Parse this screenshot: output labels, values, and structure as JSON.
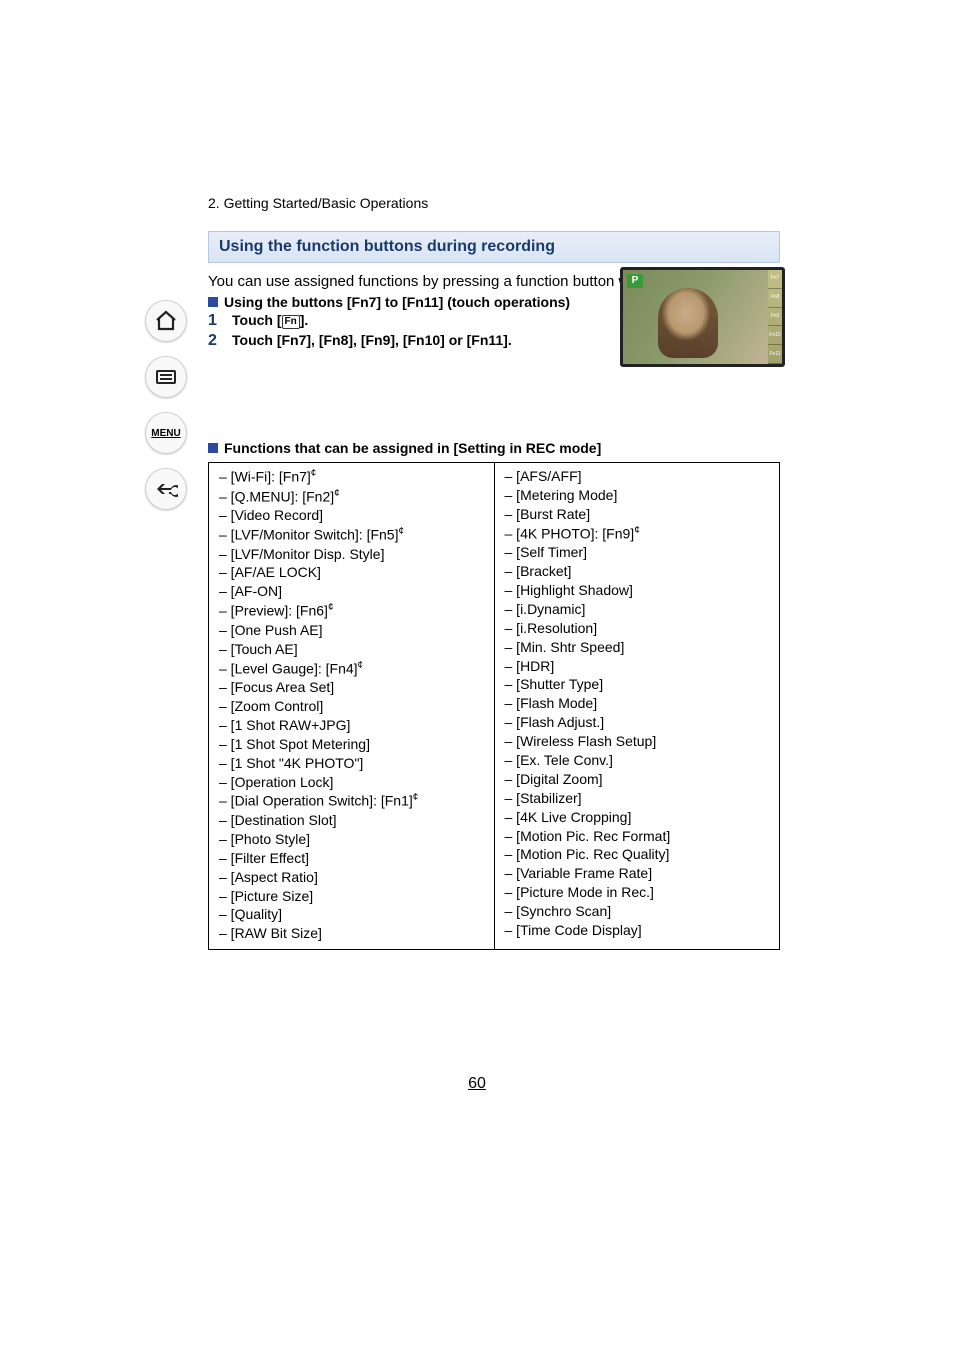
{
  "breadcrumb": "2. Getting Started/Basic Operations",
  "heading": "Using the function buttons during recording",
  "intro": "You can use assigned functions by pressing a function button when recording.",
  "sub1": "Using the buttons [Fn7] to [Fn11] (touch operations)",
  "steps": [
    {
      "num": "1",
      "text_pre": "Touch [",
      "text_post": "]."
    },
    {
      "num": "2",
      "text_pre": "Touch [Fn7], [Fn8], [Fn9], [Fn10] or [Fn11].",
      "text_post": ""
    }
  ],
  "mode_badge": "P",
  "fn_buttons": [
    "Fn7",
    "Fn8",
    "Fn9",
    "Fn10",
    "Fn11"
  ],
  "sub2": "Functions that can be assigned in [Setting in REC mode]",
  "functions_left": [
    {
      "t": "– [Wi-Fi]: [Fn7]",
      "s": "¢"
    },
    {
      "t": "– [Q.MENU]: [Fn2]",
      "s": "¢"
    },
    {
      "t": "– [Video Record]",
      "s": ""
    },
    {
      "t": "– [LVF/Monitor Switch]: [Fn5]",
      "s": "¢"
    },
    {
      "t": "– [LVF/Monitor Disp. Style]",
      "s": ""
    },
    {
      "t": "– [AF/AE LOCK]",
      "s": ""
    },
    {
      "t": "– [AF-ON]",
      "s": ""
    },
    {
      "t": "– [Preview]: [Fn6]",
      "s": "¢"
    },
    {
      "t": "– [One Push AE]",
      "s": ""
    },
    {
      "t": "– [Touch AE]",
      "s": ""
    },
    {
      "t": "– [Level Gauge]: [Fn4]",
      "s": "¢"
    },
    {
      "t": "– [Focus Area Set]",
      "s": ""
    },
    {
      "t": "– [Zoom Control]",
      "s": ""
    },
    {
      "t": "– [1 Shot RAW+JPG]",
      "s": ""
    },
    {
      "t": "– [1 Shot Spot Metering]",
      "s": ""
    },
    {
      "t": "– [1 Shot \"4K PHOTO\"]",
      "s": ""
    },
    {
      "t": "– [Operation Lock]",
      "s": ""
    },
    {
      "t": "– [Dial Operation Switch]: [Fn1]",
      "s": "¢"
    },
    {
      "t": "– [Destination Slot]",
      "s": ""
    },
    {
      "t": "– [Photo Style]",
      "s": ""
    },
    {
      "t": "– [Filter Effect]",
      "s": ""
    },
    {
      "t": "– [Aspect Ratio]",
      "s": ""
    },
    {
      "t": "– [Picture Size]",
      "s": ""
    },
    {
      "t": "– [Quality]",
      "s": ""
    },
    {
      "t": "– [RAW Bit Size]",
      "s": ""
    }
  ],
  "functions_right": [
    {
      "t": "– [AFS/AFF]",
      "s": ""
    },
    {
      "t": "– [Metering Mode]",
      "s": ""
    },
    {
      "t": "– [Burst Rate]",
      "s": ""
    },
    {
      "t": "– [4K PHOTO]: [Fn9]",
      "s": "¢"
    },
    {
      "t": "– [Self Timer]",
      "s": ""
    },
    {
      "t": "– [Bracket]",
      "s": ""
    },
    {
      "t": "– [Highlight Shadow]",
      "s": ""
    },
    {
      "t": "– [i.Dynamic]",
      "s": ""
    },
    {
      "t": "– [i.Resolution]",
      "s": ""
    },
    {
      "t": "– [Min. Shtr Speed]",
      "s": ""
    },
    {
      "t": "– [HDR]",
      "s": ""
    },
    {
      "t": "– [Shutter Type]",
      "s": ""
    },
    {
      "t": "– [Flash Mode]",
      "s": ""
    },
    {
      "t": "– [Flash Adjust.]",
      "s": ""
    },
    {
      "t": "– [Wireless Flash Setup]",
      "s": ""
    },
    {
      "t": "– [Ex. Tele Conv.]",
      "s": ""
    },
    {
      "t": "– [Digital Zoom]",
      "s": ""
    },
    {
      "t": "– [Stabilizer]",
      "s": ""
    },
    {
      "t": "– [4K Live Cropping]",
      "s": ""
    },
    {
      "t": "– [Motion Pic. Rec Format]",
      "s": ""
    },
    {
      "t": "– [Motion Pic. Rec Quality]",
      "s": ""
    },
    {
      "t": "– [Variable Frame Rate]",
      "s": ""
    },
    {
      "t": "– [Picture Mode in Rec.]",
      "s": ""
    },
    {
      "t": "– [Synchro Scan]",
      "s": ""
    },
    {
      "t": "– [Time Code Display]",
      "s": ""
    }
  ],
  "page_number": "60",
  "sidebar": {
    "menu": "MENU"
  }
}
